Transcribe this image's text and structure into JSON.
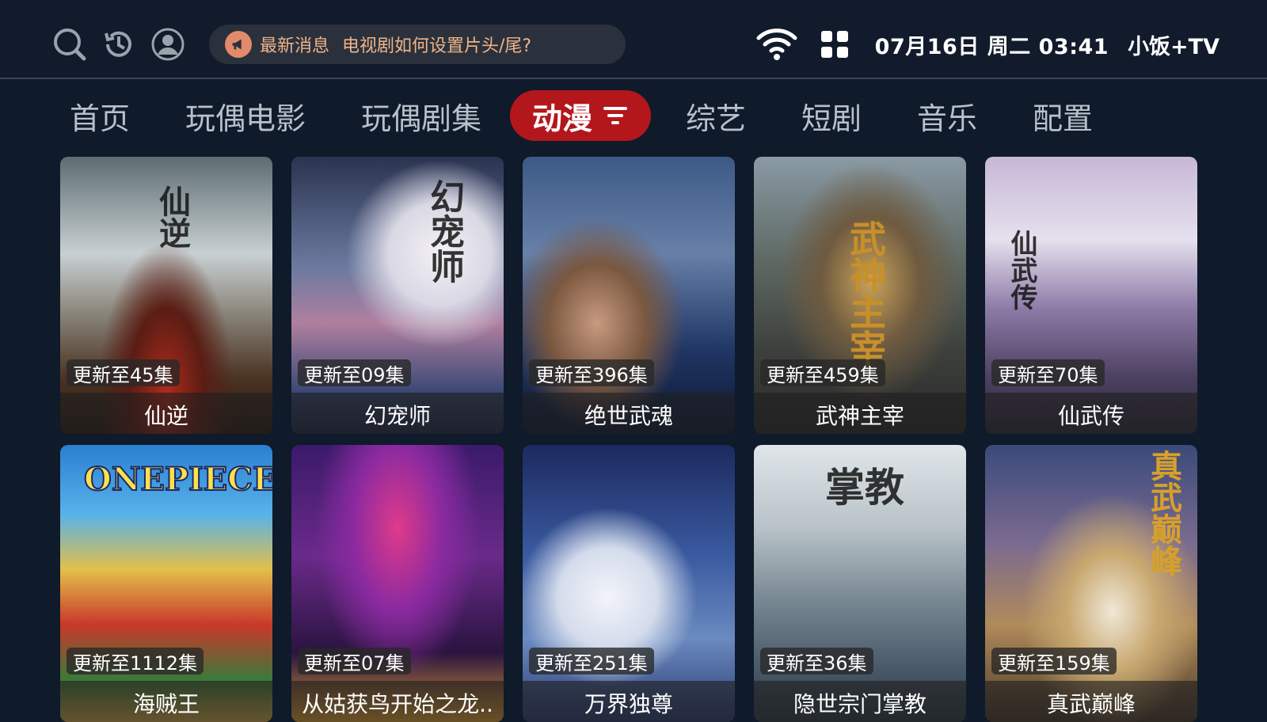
{
  "topbar": {
    "news_title": "最新消息",
    "news_text": "电视剧如何设置片头/尾?",
    "datetime": "07月16日 周二 03:41",
    "brand": "小饭+TV"
  },
  "tabs": [
    {
      "label": "首页"
    },
    {
      "label": "玩偶电影"
    },
    {
      "label": "玩偶剧集"
    },
    {
      "label": "动漫"
    },
    {
      "label": "综艺"
    },
    {
      "label": "短剧"
    },
    {
      "label": "音乐"
    },
    {
      "label": "配置"
    }
  ],
  "active_tab": "动漫",
  "cards": [
    {
      "title": "仙逆",
      "badge": "更新至45集"
    },
    {
      "title": "幻宠师",
      "badge": "更新至09集"
    },
    {
      "title": "绝世武魂",
      "badge": "更新至396集"
    },
    {
      "title": "武神主宰",
      "badge": "更新至459集"
    },
    {
      "title": "仙武传",
      "badge": "更新至70集"
    },
    {
      "title": "海贼王",
      "badge": "更新至1112集"
    },
    {
      "title": "从姑获鸟开始之龙..",
      "badge": "更新至07集"
    },
    {
      "title": "万界独尊",
      "badge": "更新至251集"
    },
    {
      "title": "隐世宗门掌教",
      "badge": "更新至36集"
    },
    {
      "title": "真武巅峰",
      "badge": "更新至159集"
    }
  ],
  "poster_art": {
    "c0": "仙逆",
    "c1": "幻宠师",
    "c3": "武神主宰",
    "c4": "仙武传",
    "c5": "ONEPIECE",
    "c8": "掌教",
    "c9": "真武巅峰"
  },
  "colors": {
    "background": "#0f1a2a",
    "active_tab": "#b3171c",
    "news_accent": "#f0b389"
  }
}
